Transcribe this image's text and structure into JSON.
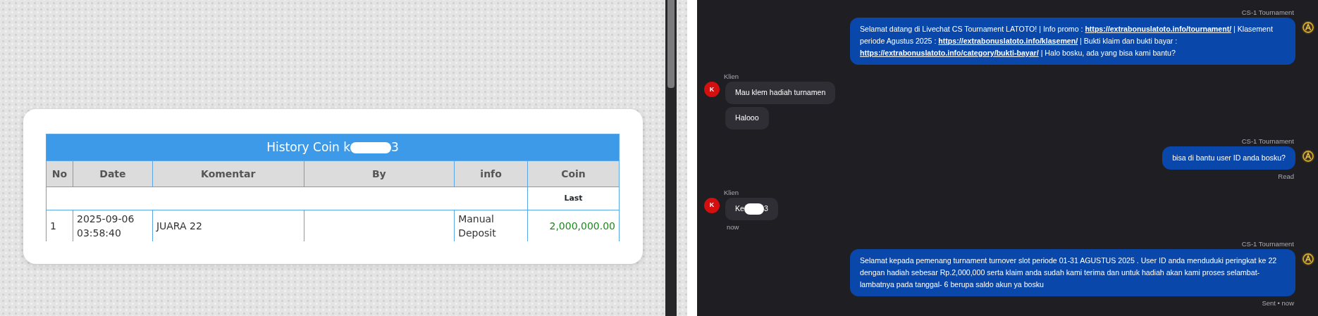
{
  "history": {
    "title_start": "History Coin k",
    "title_end": "3",
    "columns": [
      "No",
      "Date",
      "Komentar",
      "By",
      "info",
      "Coin"
    ],
    "subheader": "Last",
    "rows": [
      {
        "no": "1",
        "date": "2025-09-06 03:58:40",
        "komentar": "JUARA 22",
        "by": "",
        "info": "Manual Deposit",
        "coin": "2,000,000.00"
      }
    ]
  },
  "chat": [
    {
      "kind": "agent",
      "sender": "CS-1 Tournament",
      "segments": [
        {
          "kind": "text",
          "text": "Selamat datang di Livechat CS Tournament LATOTO! | Info promo :"
        },
        {
          "kind": "link",
          "text": "https://extrabonuslatoto.info/tournament/"
        },
        {
          "kind": "text",
          "text": "| Klasement periode Agustus 2025 :"
        },
        {
          "kind": "link",
          "text": "https://extrabonuslatoto.info/klasemen/"
        },
        {
          "kind": "text",
          "text": "| Bukti klaim dan bukti bayar :"
        },
        {
          "kind": "link",
          "text": "https://extrabonuslatoto.info/category/bukti-bayar/"
        },
        {
          "kind": "text",
          "text": "| Halo bosku, ada yang bisa kami bantu?"
        }
      ]
    },
    {
      "kind": "client",
      "sender": "Klien",
      "avatar": "K",
      "bubbles": [
        {
          "start": "Mau klem hadiah turnamen"
        },
        {
          "start": "Halooo"
        }
      ]
    },
    {
      "kind": "agent",
      "sender": "CS-1 Tournament",
      "segments": [
        {
          "kind": "text",
          "text": "bisa di bantu user ID anda bosku?"
        }
      ],
      "status": "Read"
    },
    {
      "kind": "client",
      "sender": "Klien",
      "avatar": "K",
      "bubbles": [
        {
          "start": "Ke",
          "end": "3"
        }
      ],
      "status": "now"
    },
    {
      "kind": "agent",
      "sender": "CS-1 Tournament",
      "segments": [
        {
          "kind": "text",
          "text": "Selamat kepada pemenang turnament turnover slot periode 01-31 AGUSTUS 2025 . User ID anda menduduki peringkat ke 22 dengan hadiah sebesar Rp.2,000,000 serta klaim anda sudah kami terima dan untuk hadiah akan kami proses selambat-lambatnya pada tanggal- 6 berupa saldo akun ya bosku"
        }
      ],
      "status": "Sent • now"
    }
  ]
}
